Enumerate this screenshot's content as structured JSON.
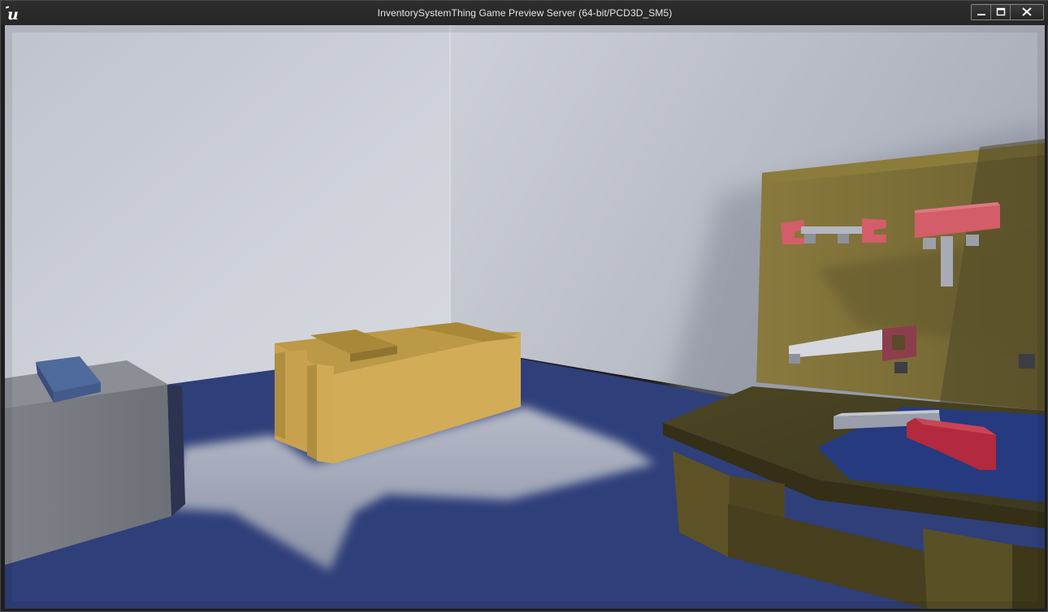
{
  "window": {
    "title": "InventorySystemThing Game Preview Server (64-bit/PCD3D_SM5)",
    "app_icon": "unreal-engine-logo",
    "controls": [
      "minimize",
      "maximize",
      "close"
    ]
  },
  "scene": {
    "objects": [
      "gray-crate",
      "yellow-crate",
      "workbench",
      "pegboard",
      "wrench",
      "hammer",
      "saw",
      "mallet"
    ],
    "colors": {
      "floor": "#2f3f7a",
      "floor_lit": "#a4aab8",
      "wall_left": "#c9cdd6",
      "wall_right": "#babec8",
      "yellow": "#c8a24e",
      "bench": "#5b5124",
      "tool_red": "#d35d69"
    }
  }
}
